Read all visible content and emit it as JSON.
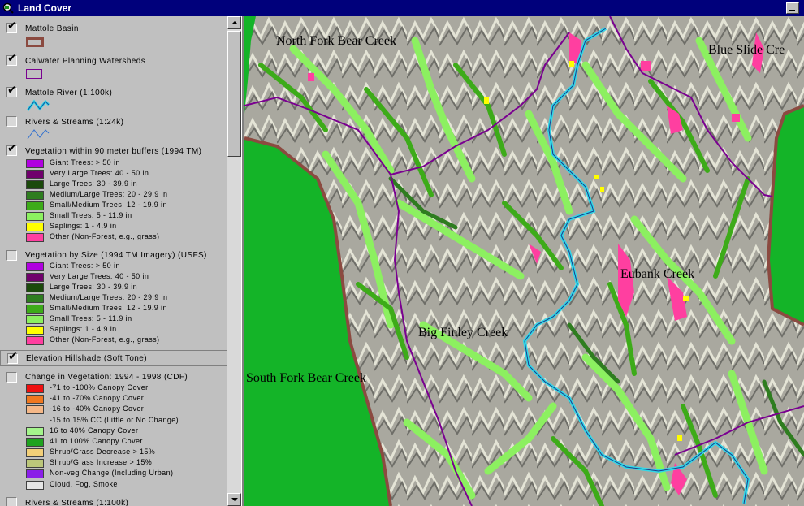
{
  "window": {
    "title": "Land Cover"
  },
  "legend": {
    "mattole_basin": {
      "label": "Mattole Basin",
      "checked": true
    },
    "calwater": {
      "label": "Calwater Planning Watersheds",
      "checked": true
    },
    "mattole_river": {
      "label": "Mattole River (1:100k)",
      "checked": true
    },
    "rivers_streams_24k": {
      "label": "Rivers & Streams (1:24k)",
      "checked": false
    },
    "vegetation_buffers": {
      "label": "Vegetation within 90 meter buffers (1994 TM)",
      "checked": true,
      "items": [
        {
          "label": "Giant Trees: > 50 in",
          "color": "#b000e0"
        },
        {
          "label": "Very Large Trees: 40 - 50 in",
          "color": "#70006c"
        },
        {
          "label": "Large Trees: 30 - 39.9 in",
          "color": "#1b4a0b"
        },
        {
          "label": "Medium/Large Trees: 20 - 29.9 in",
          "color": "#2e7d1f"
        },
        {
          "label": "Small/Medium Trees: 12 - 19.9 in",
          "color": "#3dab19"
        },
        {
          "label": "Small Trees: 5 - 11.9 in",
          "color": "#8cf060"
        },
        {
          "label": "Saplings: 1 - 4.9 in",
          "color": "#ffff00"
        },
        {
          "label": "Other (Non-Forest, e.g., grass)",
          "color": "#ff3fa0"
        }
      ]
    },
    "vegetation_size": {
      "label": "Vegetation by Size (1994 TM Imagery) (USFS)",
      "checked": false,
      "items": [
        {
          "label": "Giant Trees: > 50 in",
          "color": "#b000e0"
        },
        {
          "label": "Very Large Trees: 40 - 50 in",
          "color": "#70006c"
        },
        {
          "label": "Large Trees: 30 - 39.9 in",
          "color": "#1b4a0b"
        },
        {
          "label": "Medium/Large Trees: 20 - 29.9 in",
          "color": "#2e7d1f"
        },
        {
          "label": "Small/Medium Trees: 12 - 19.9 in",
          "color": "#3dab19"
        },
        {
          "label": "Small Trees: 5 - 11.9 in",
          "color": "#8cf060"
        },
        {
          "label": "Saplings: 1 - 4.9 in",
          "color": "#ffff00"
        },
        {
          "label": "Other (Non-Forest, e.g., grass)",
          "color": "#ff3fa0"
        }
      ]
    },
    "hillshade": {
      "label": "Elevation Hillshade (Soft Tone)",
      "checked": true
    },
    "change": {
      "label": "Change in Vegetation: 1994 - 1998 (CDF)",
      "checked": false,
      "items": [
        {
          "label": "-71 to -100% Canopy Cover",
          "color": "#ee1010"
        },
        {
          "label": "-41 to -70% Canopy Cover",
          "color": "#f07820"
        },
        {
          "label": "-16 to -40% Canopy Cover",
          "color": "#f5b888"
        },
        {
          "label": "-15 to 15% CC (Little or No Change)",
          "color": ""
        },
        {
          "label": "16 to 40% Canopy Cover",
          "color": "#a4f58c"
        },
        {
          "label": "41 to 100% Canopy Cover",
          "color": "#1fa21f"
        },
        {
          "label": "Shrub/Grass Decrease > 15%",
          "color": "#f2cf78"
        },
        {
          "label": "Shrub/Grass Increase > 15%",
          "color": "#bcc77a"
        },
        {
          "label": "Non-veg Change (Including Urban)",
          "color": "#8a1ee8"
        },
        {
          "label": "Cloud, Fog, Smoke",
          "color": "#e6e6e6"
        }
      ]
    },
    "rivers_streams_100k": {
      "label": "Rivers & Streams (1:100k)",
      "checked": false
    }
  },
  "map": {
    "labels": {
      "north_fork": "North Fork Bear Creek",
      "blue_slide": "Blue Slide Cre",
      "eubank": "Eubank Creek",
      "big_finley": "Big Finley Creek",
      "south_fork": "South Fork Bear Creek"
    },
    "colors": {
      "outside": "#14b428",
      "basin_border": "#8b4a40",
      "watershed": "#7a0090",
      "river": "#30d8e8",
      "terrain": "#a9a89f"
    }
  }
}
